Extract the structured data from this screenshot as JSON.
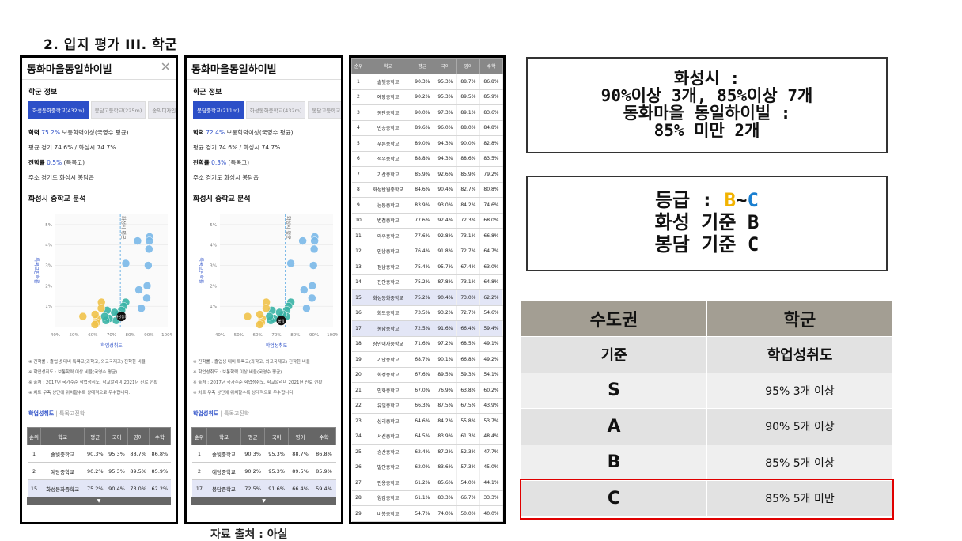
{
  "slide_title": "2. 입지 평가 III. 학군",
  "source_note": "자료 출처 : 아실",
  "left_panel": {
    "title": "동화마을동일하이빌",
    "section": "학군 정보",
    "tabs": [
      "화성동화중학교(432m)",
      "봉담고등학교(225m)",
      "송익디자인"
    ],
    "academic_label": "학력",
    "academic_value": "75.2%",
    "academic_rest": "보통학력이상(국영수 평균)",
    "avg": "평균 경기 74.6% / 화성시 74.7%",
    "transfer_label": "전학률",
    "transfer_value": "0.5%",
    "transfer_rest": "(특목고)",
    "address": "주소 경기도 화성시 봉담읍",
    "chart_title": "화성시 중학교 분석",
    "highlight_label": "화성동화",
    "notes": [
      "※ 진학률 : 졸업생 대비 특목고(과학고, 외고국제고) 진학한 비율",
      "※ 학업성취도 : 보통학력 이상 비율(국영수 평균)",
      "※ 출처 : 2017년 국가수준 학업성취도, 학교알리미 2021년 진로 현황",
      "※ 차트 우측 상단에 위치할수록 상대적으로 우수합니다."
    ],
    "subtabs": [
      "학업성취도",
      "특목고진학"
    ],
    "table_header": [
      "순위",
      "학교",
      "평균",
      "국어",
      "영어",
      "수학"
    ],
    "table_rows": [
      [
        "1",
        "솔빛중학교",
        "90.3%",
        "95.3%",
        "88.7%",
        "86.8%"
      ],
      [
        "2",
        "예당중학교",
        "90.2%",
        "95.3%",
        "89.5%",
        "85.9%"
      ],
      [
        "15",
        "화성동화중학교",
        "75.2%",
        "90.4%",
        "73.0%",
        "62.2%"
      ]
    ],
    "highlight_row": 2,
    "foot": "▼"
  },
  "mid_panel": {
    "title": "동화마을동일하이빌",
    "section": "학군 정보",
    "tabs": [
      "봉담중학교(211m)",
      "화성동화중학교(432m)",
      "봉담고등학교"
    ],
    "academic_label": "학력",
    "academic_value": "72.4%",
    "academic_rest": "보통학력이상(국영수 평균)",
    "avg": "평균 경기 74.6% / 화성시 74.7%",
    "transfer_label": "전학률",
    "transfer_value": "0.3%",
    "transfer_rest": "(특목고)",
    "address": "주소 경기도 화성시 봉담읍",
    "chart_title": "화성시 중학교 분석",
    "highlight_label": "봉담",
    "notes": [
      "※ 진학률 : 졸업생 대비 특목고(과학고, 외고국제고) 진학한 비율",
      "※ 학업성취도 : 보통학력 이상 비율(국영수 평균)",
      "※ 출처 : 2017년 국가수준 학업성취도, 학교알리미 2021년 진로 현황",
      "※ 차트 우측 상단에 위치할수록 상대적으로 우수합니다."
    ],
    "subtabs": [
      "학업성취도",
      "특목고진학"
    ],
    "table_header": [
      "순위",
      "학교",
      "평균",
      "국어",
      "영어",
      "수학"
    ],
    "table_rows": [
      [
        "1",
        "솔빛중학교",
        "90.3%",
        "95.3%",
        "88.7%",
        "86.8%"
      ],
      [
        "2",
        "예당중학교",
        "90.2%",
        "95.3%",
        "89.5%",
        "85.9%"
      ],
      [
        "17",
        "봉담중학교",
        "72.5%",
        "91.6%",
        "66.4%",
        "59.4%"
      ]
    ],
    "highlight_row": 2,
    "foot": "▼"
  },
  "chart_data": {
    "type": "scatter",
    "xlabel": "학업성취도",
    "ylabel": "특목고진학률",
    "xticks": [
      "40%",
      "50%",
      "60%",
      "70%",
      "80%",
      "90%",
      "100%"
    ],
    "yticks": [
      "1%",
      "2%",
      "3%",
      "4%",
      "5%"
    ],
    "xlim": [
      40,
      100
    ],
    "ylim": [
      0,
      5.5
    ],
    "ref_label": "화성시 평균",
    "ref_x": 74.7,
    "points": [
      {
        "x": 90.3,
        "y": 4.4
      },
      {
        "x": 90.2,
        "y": 4.2
      },
      {
        "x": 90.0,
        "y": 3.8
      },
      {
        "x": 89.6,
        "y": 3.0
      },
      {
        "x": 89.0,
        "y": 2.0
      },
      {
        "x": 88.8,
        "y": 1.4
      },
      {
        "x": 85.9,
        "y": 0.9
      },
      {
        "x": 84.6,
        "y": 1.8
      },
      {
        "x": 83.9,
        "y": 4.2
      },
      {
        "x": 77.6,
        "y": 3.1
      },
      {
        "x": 77.6,
        "y": 1.2
      },
      {
        "x": 76.4,
        "y": 1.0
      },
      {
        "x": 75.4,
        "y": 0.8
      },
      {
        "x": 75.2,
        "y": 0.5
      },
      {
        "x": 73.5,
        "y": 0.6
      },
      {
        "x": 72.5,
        "y": 0.3
      },
      {
        "x": 71.6,
        "y": 0.7
      },
      {
        "x": 68.7,
        "y": 0.4
      },
      {
        "x": 67.6,
        "y": 0.8
      },
      {
        "x": 67.0,
        "y": 0.3
      },
      {
        "x": 66.3,
        "y": 0.5
      },
      {
        "x": 64.6,
        "y": 1.2
      },
      {
        "x": 64.5,
        "y": 0.9
      },
      {
        "x": 62.4,
        "y": 0.4
      },
      {
        "x": 62.0,
        "y": 0.2
      },
      {
        "x": 61.2,
        "y": 0.6
      },
      {
        "x": 61.1,
        "y": 0.1
      },
      {
        "x": 54.7,
        "y": 0.5
      }
    ]
  },
  "rank_table": {
    "header": [
      "순위",
      "학교",
      "평균",
      "국어",
      "영어",
      "수학"
    ],
    "rows": [
      [
        "1",
        "솔빛중학교",
        "90.3%",
        "95.3%",
        "88.7%",
        "86.8%"
      ],
      [
        "2",
        "예당중학교",
        "90.2%",
        "95.3%",
        "89.5%",
        "85.9%"
      ],
      [
        "3",
        "동탄중학교",
        "90.0%",
        "97.3%",
        "89.1%",
        "83.6%"
      ],
      [
        "4",
        "반송중학교",
        "89.6%",
        "96.0%",
        "88.0%",
        "84.8%"
      ],
      [
        "5",
        "푸른중학교",
        "89.0%",
        "94.3%",
        "90.0%",
        "82.8%"
      ],
      [
        "6",
        "석우중학교",
        "88.8%",
        "94.3%",
        "88.6%",
        "83.5%"
      ],
      [
        "7",
        "기산중학교",
        "85.9%",
        "92.6%",
        "85.9%",
        "79.2%"
      ],
      [
        "8",
        "화성반월중학교",
        "84.6%",
        "90.4%",
        "82.7%",
        "80.8%"
      ],
      [
        "9",
        "능동중학교",
        "83.9%",
        "93.0%",
        "84.2%",
        "74.6%"
      ],
      [
        "10",
        "병점중학교",
        "77.6%",
        "92.4%",
        "72.3%",
        "68.0%"
      ],
      [
        "11",
        "와우중학교",
        "77.6%",
        "92.8%",
        "73.1%",
        "66.8%"
      ],
      [
        "12",
        "안남중학교",
        "76.4%",
        "91.8%",
        "72.7%",
        "64.7%"
      ],
      [
        "13",
        "정남중학교",
        "75.4%",
        "95.7%",
        "67.4%",
        "63.0%"
      ],
      [
        "14",
        "진안중학교",
        "75.2%",
        "87.8%",
        "73.1%",
        "64.8%"
      ],
      [
        "15",
        "화성동화중학교",
        "75.2%",
        "90.4%",
        "73.0%",
        "62.2%"
      ],
      [
        "16",
        "화도중학교",
        "73.5%",
        "93.2%",
        "72.7%",
        "54.6%"
      ],
      [
        "17",
        "봉담중학교",
        "72.5%",
        "91.6%",
        "66.4%",
        "59.4%"
      ],
      [
        "18",
        "장안여자중학교",
        "71.6%",
        "97.2%",
        "68.5%",
        "49.1%"
      ],
      [
        "19",
        "기안중학교",
        "68.7%",
        "90.1%",
        "66.8%",
        "49.2%"
      ],
      [
        "20",
        "화성중학교",
        "67.6%",
        "89.5%",
        "59.3%",
        "54.1%"
      ],
      [
        "21",
        "안화중학교",
        "67.0%",
        "76.9%",
        "63.8%",
        "60.2%"
      ],
      [
        "22",
        "유일중학교",
        "66.3%",
        "87.5%",
        "67.5%",
        "43.9%"
      ],
      [
        "23",
        "상리중학교",
        "64.6%",
        "84.2%",
        "55.8%",
        "53.7%"
      ],
      [
        "24",
        "서신중학교",
        "64.5%",
        "83.9%",
        "61.3%",
        "48.4%"
      ],
      [
        "25",
        "송산중학교",
        "62.4%",
        "87.2%",
        "52.3%",
        "47.7%"
      ],
      [
        "26",
        "발안중학교",
        "62.0%",
        "83.6%",
        "57.3%",
        "45.0%"
      ],
      [
        "27",
        "안용중학교",
        "61.2%",
        "85.6%",
        "54.0%",
        "44.1%"
      ],
      [
        "28",
        "양감중학교",
        "61.1%",
        "83.3%",
        "66.7%",
        "33.3%"
      ],
      [
        "29",
        "비봉중학교",
        "54.7%",
        "74.0%",
        "50.0%",
        "40.0%"
      ]
    ],
    "highlight_rows": [
      14,
      16
    ]
  },
  "summary": {
    "line1": "화성시 :",
    "line2": "90%이상 3개, 85%이상 7개",
    "line3": "동화마을 동일하이빌 :",
    "line4": "85% 미만 2개"
  },
  "grade": {
    "prefix": "등급 : ",
    "b": "B",
    "tilde": "~",
    "c": "C",
    "line2": "화성 기준 B",
    "line3": "봉담 기준 C"
  },
  "criteria": {
    "col1": "수도권",
    "col2": "학군",
    "sub1": "기준",
    "sub2": "학업성취도",
    "rows": [
      [
        "S",
        "95% 3개 이상"
      ],
      [
        "A",
        "90% 5개 이상"
      ],
      [
        "B",
        "85% 5개 이상"
      ],
      [
        "C",
        "85% 5개 미만"
      ]
    ]
  },
  "colors": {
    "accent_blue": "#2c4fc8",
    "grade_b": "#f2b300",
    "grade_c": "#1a7fd0",
    "highlight_border": "#e00000",
    "header_beige": "#a39e93"
  }
}
